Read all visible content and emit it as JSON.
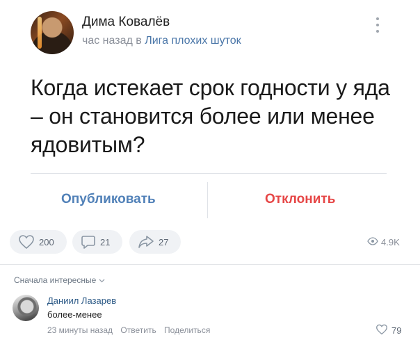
{
  "post": {
    "author": "Дима Ковалёв",
    "time": "час назад",
    "preposition": "в",
    "group": "Лига плохих шуток",
    "text": "Когда истекает срок годности у яда – он становится более или менее ядовитым?",
    "publish_label": "Опубликовать",
    "reject_label": "Отклонить"
  },
  "stats": {
    "likes": "200",
    "comments": "21",
    "shares": "27",
    "views": "4.9K"
  },
  "comments_section": {
    "sort_label": "Сначала интересные",
    "items": [
      {
        "author": "Даниил Лазарев",
        "text": "более-менее",
        "time": "23 минуты назад",
        "reply_label": "Ответить",
        "share_label": "Поделиться",
        "likes": "79"
      }
    ]
  },
  "colors": {
    "link": "#4a76a8",
    "publish": "#5181b8",
    "reject": "#e64646",
    "muted": "#8a8f99",
    "pill_bg": "#f0f2f5"
  },
  "icons": [
    "more-vertical-icon",
    "heart-icon",
    "comment-icon",
    "share-icon",
    "eye-icon",
    "chevron-down-icon"
  ]
}
